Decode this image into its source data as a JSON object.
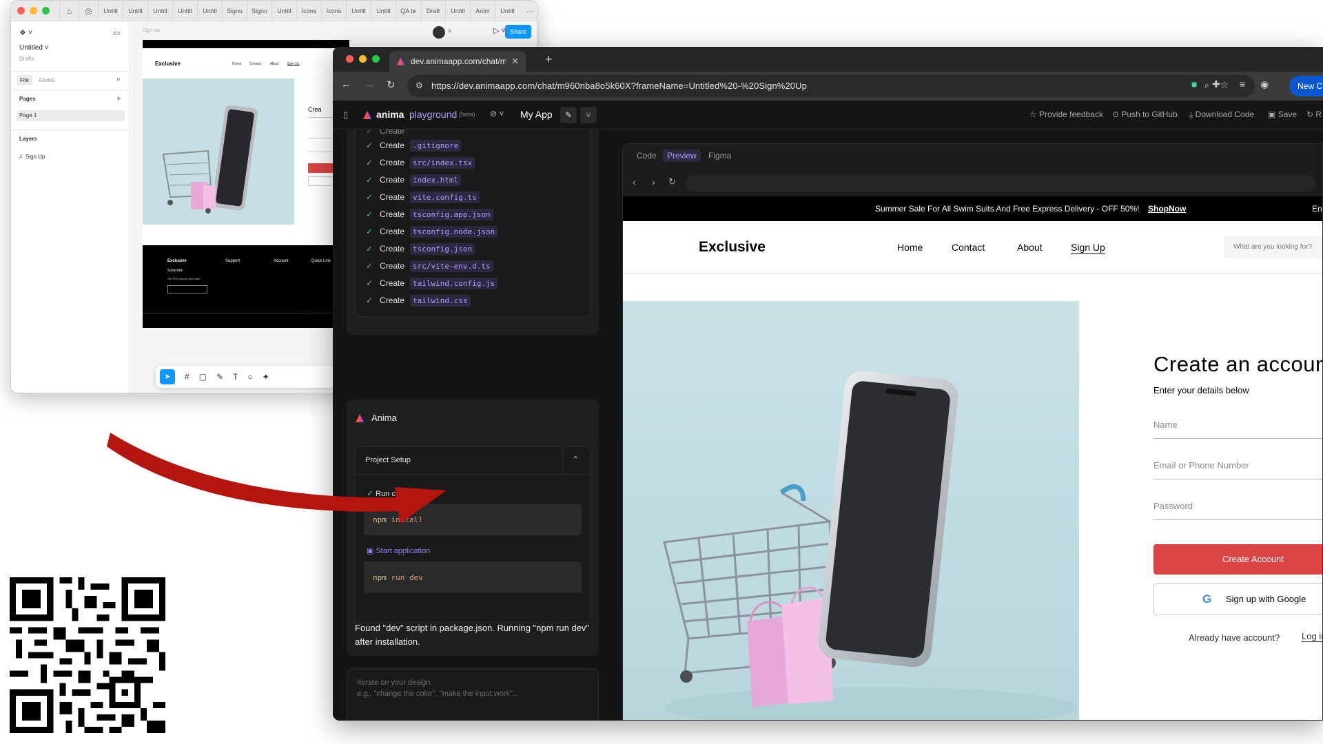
{
  "figma": {
    "tabs": [
      "Untitl",
      "Untitl",
      "Untitl",
      "Untitl",
      "Untitl",
      "Signu",
      "Signu",
      "Untitl",
      "Icons",
      "Icons",
      "Untitl",
      "Untitl",
      "QA te",
      "Draft",
      "Untitl",
      "Anim",
      "Untitl"
    ],
    "file_name": "Untitled",
    "drafts_label": "Drafts",
    "file_tab": "File",
    "assets_tab": "Assets",
    "pages_heading": "Pages",
    "page_1": "Page 1",
    "layers_heading": "Layers",
    "layer_1": "Sign Up",
    "share_label": "Share",
    "frame_label": "Sign Up",
    "mini_brand": "Exclusive",
    "mini_nav": [
      "Home",
      "Contact",
      "About",
      "Sign Up"
    ],
    "mini_heading": "Crea",
    "mini_footer": {
      "brand": "Exclusive",
      "subscribe": "Subscribe",
      "offer": "Get 10% off your first order",
      "support": "Support",
      "account": "Account",
      "quick_link": "Quick Link"
    }
  },
  "browser": {
    "tab_title": "dev.animaapp.com/chat/m96",
    "url": "https://dev.animaapp.com/chat/m960nba8o5k60X?frameName=Untitled%20-%20Sign%20Up",
    "new_chat": "New C"
  },
  "appbar": {
    "brand": "anima",
    "product": "playground",
    "beta": "(beta)",
    "app_name": "My App",
    "provide_feedback": "Provide feedback",
    "push_github": "Push to GitHub",
    "download_code": "Download Code",
    "save": "Save",
    "more": "R"
  },
  "chat": {
    "files": [
      {
        "verb": "Create",
        "file": ".gitignore"
      },
      {
        "verb": "Create",
        "file": "src/index.tsx"
      },
      {
        "verb": "Create",
        "file": "index.html"
      },
      {
        "verb": "Create",
        "file": "vite.config.ts"
      },
      {
        "verb": "Create",
        "file": "tsconfig.app.json"
      },
      {
        "verb": "Create",
        "file": "tsconfig.node.json"
      },
      {
        "verb": "Create",
        "file": "tsconfig.json"
      },
      {
        "verb": "Create",
        "file": "src/vite-env.d.ts"
      },
      {
        "verb": "Create",
        "file": "tailwind.config.js"
      },
      {
        "verb": "Create",
        "file": "tailwind.css"
      }
    ],
    "agent_name": "Anima",
    "section_title": "Project Setup",
    "run_command_label": "Run command",
    "cmd_1_bin": "npm",
    "cmd_1_arg": "install",
    "start_app_label": "Start application",
    "cmd_2_bin": "npm",
    "cmd_2_arg": "run dev",
    "message": "Found \"dev\" script in package.json. Running \"npm run dev\" after installation.",
    "input_placeholder_1": "Iterate on your design.",
    "input_placeholder_2": "e.g., \"change the color\", \"make the input work\"..."
  },
  "preview": {
    "tabs": {
      "code": "Code",
      "preview": "Preview",
      "figma": "Figma"
    },
    "banner_text": "Summer Sale For All Swim Suits And Free Express Delivery - OFF 50%!",
    "banner_link": "ShopNow",
    "banner_lang": "En",
    "brand": "Exclusive",
    "nav": {
      "home": "Home",
      "contact": "Contact",
      "about": "About",
      "signup": "Sign Up"
    },
    "search_placeholder": "What are you looking for?",
    "heading": "Create an accoun",
    "subheading": "Enter your details below",
    "name_placeholder": "Name",
    "email_placeholder": "Email or Phone Number",
    "password_placeholder": "Password",
    "create_btn": "Create Account",
    "google_btn": "Sign up with Google",
    "already": "Already have account?",
    "login": "Log in"
  },
  "colors": {
    "accent_red": "#db4444",
    "anima_purple": "#b59cff",
    "share_blue": "#0d99ff",
    "arrow_red": "#b5150f"
  }
}
